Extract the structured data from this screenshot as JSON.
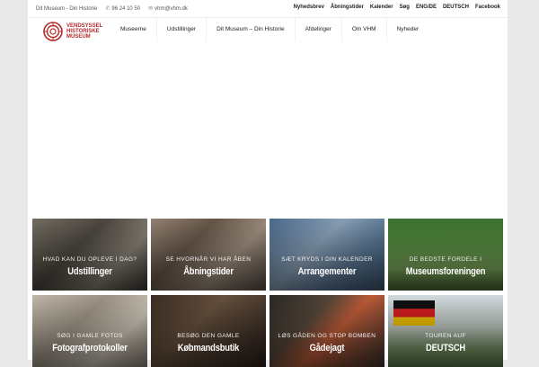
{
  "topbar": {
    "site_name": "Dit Museum - Din Historie",
    "phone": "96 24 10 50",
    "email": "vhm@vhm.dk",
    "links": [
      "Nyhedsbrev",
      "Åbningstider",
      "Kalender",
      "Søg",
      "ENG/DE",
      "DEUTSCH",
      "Facebook"
    ]
  },
  "logo": {
    "line1": "Vendsyssel",
    "line2": "Historiske",
    "line3": "Museum",
    "color": "#b52a2a"
  },
  "nav": [
    "Museerne",
    "Udstillinger",
    "Dit Museum – Din Historie",
    "Afdelinger",
    "Om VHM",
    "Nyheder"
  ],
  "tiles": [
    {
      "sub": "Hvad kan du opleve i dag?",
      "title": "Udstillinger"
    },
    {
      "sub": "Se hvornår vi har åben",
      "title": "Åbningstider"
    },
    {
      "sub": "Sæt kryds i din kalender",
      "title": "Arrangementer"
    },
    {
      "sub": "De bedste fordele i",
      "title": "Museumsforeningen"
    },
    {
      "sub": "Søg i gamle fotos",
      "title": "Fotografprotokoller"
    },
    {
      "sub": "Besøg den gamle",
      "title": "Købmandsbutik"
    },
    {
      "sub": "Løs gåden og stop bomben",
      "title": "Gådejagt"
    },
    {
      "sub": "Touren auf",
      "title": "DEUTSCH"
    }
  ]
}
